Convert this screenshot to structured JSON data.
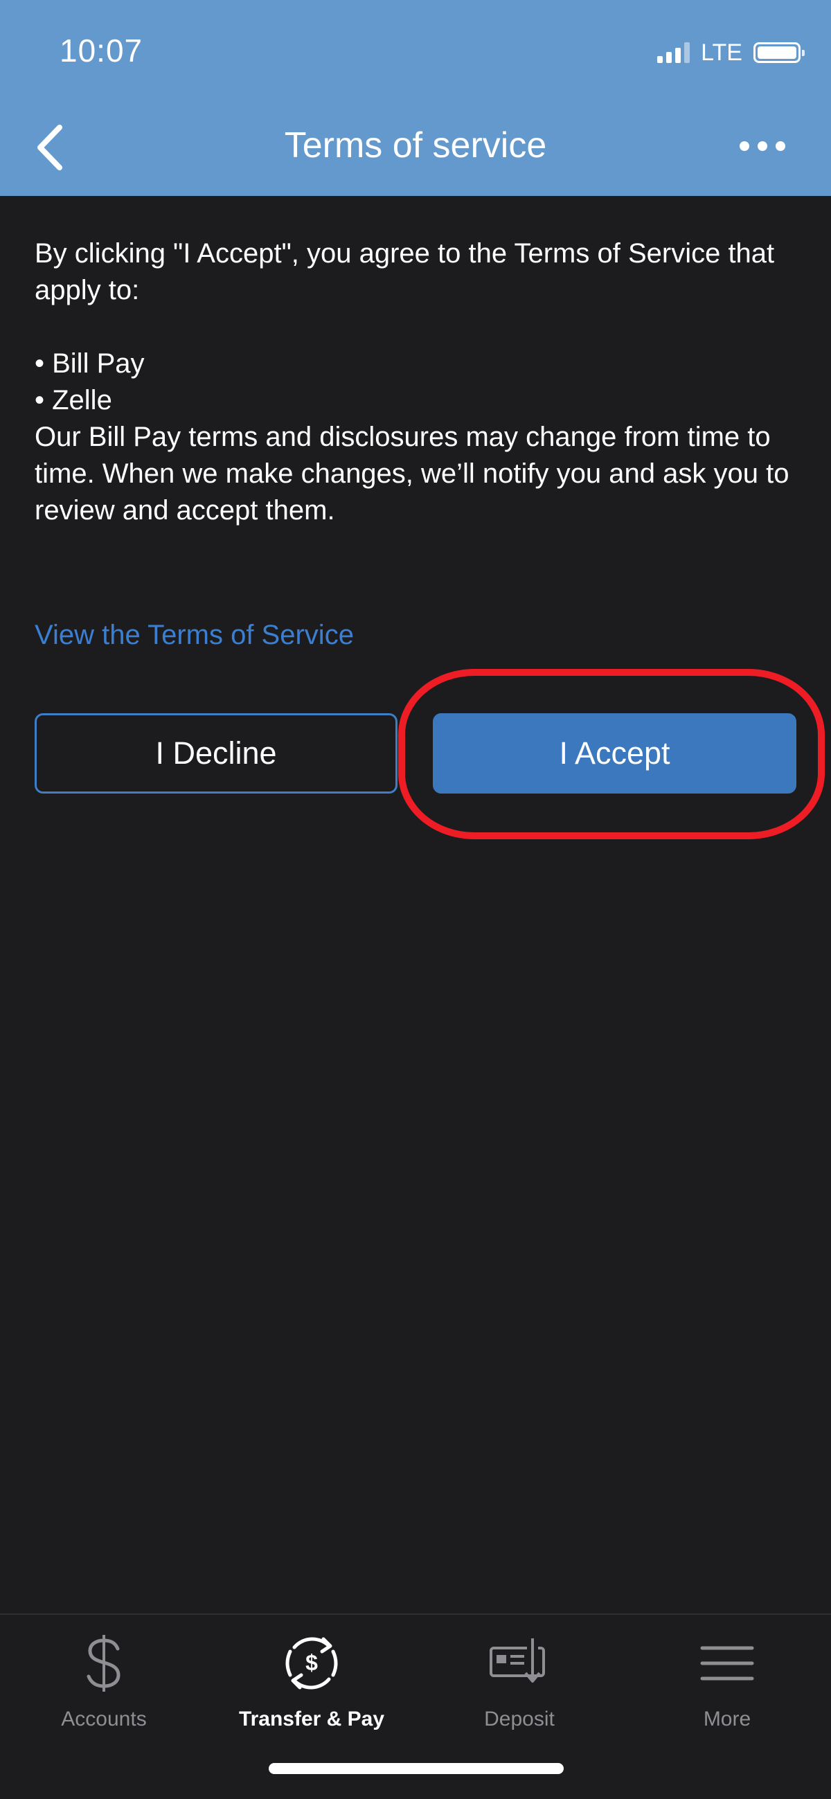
{
  "status_bar": {
    "time": "10:07",
    "network": "LTE"
  },
  "nav": {
    "title": "Terms of service"
  },
  "content": {
    "intro": "By clicking \"I Accept\", you agree to the Terms of Service that apply to:",
    "bullets": [
      "• Bill Pay",
      "• Zelle"
    ],
    "notice": "Our Bill Pay terms and disclosures may change from time to time. When we make changes, we’ll notify you and ask you to review and accept them."
  },
  "link": {
    "label": "View the Terms of Service"
  },
  "buttons": {
    "decline": "I Decline",
    "accept": "I Accept"
  },
  "tabs": [
    {
      "label": "Accounts",
      "icon": "dollar-icon"
    },
    {
      "label": "Transfer & Pay",
      "icon": "transfer-pay-icon"
    },
    {
      "label": "Deposit",
      "icon": "deposit-check-icon"
    },
    {
      "label": "More",
      "icon": "menu-icon"
    }
  ],
  "colors": {
    "header": "#6499cd",
    "background": "#1c1c1e",
    "accent": "#3b78bd",
    "link": "#3a7fd2",
    "highlight": "#ee1c25"
  }
}
